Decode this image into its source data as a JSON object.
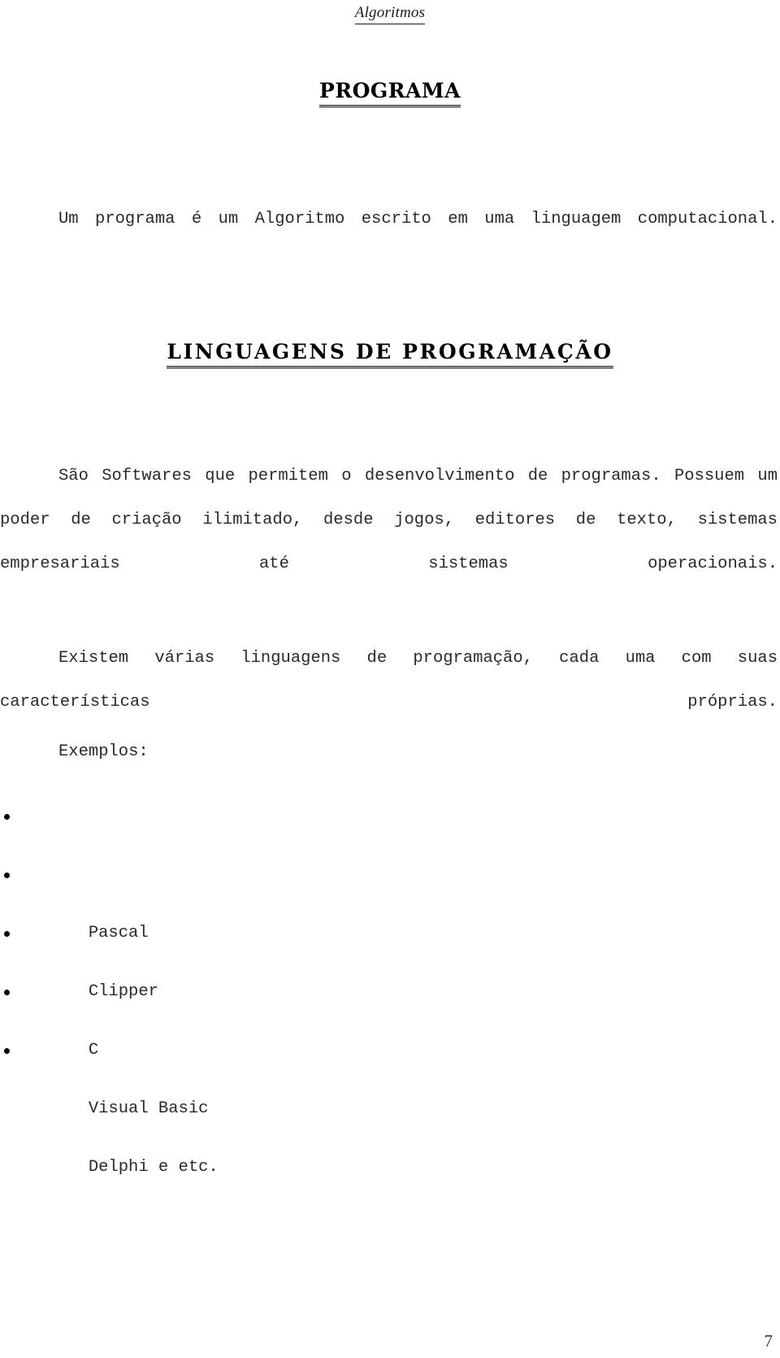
{
  "document": {
    "running_header": "Algoritmos",
    "page_number": "7",
    "text_color": "#2a2a2a",
    "heading_color": "#000000",
    "background": "#ffffff"
  },
  "sections": {
    "programa": {
      "heading": "PROGRAMA",
      "paragraph": "Um programa é um Algoritmo escrito em uma linguagem computacional."
    },
    "linguagens": {
      "heading": "LINGUAGENS DE PROGRAMAÇÃO",
      "paragraph_1": "São Softwares que permitem o desenvolvimento de programas. Possuem um poder de criação ilimitado, desde jogos, editores de texto, sistemas empresariais até sistemas operacionais.",
      "paragraph_2": "Existem várias linguagens de programação, cada uma com suas características próprias.",
      "examples_label": "Exemplos:",
      "examples": [
        {
          "label": "Pascal"
        },
        {
          "label": "Clipper"
        },
        {
          "label": "C"
        },
        {
          "label": "Visual Basic"
        },
        {
          "label": "Delphi e etc."
        }
      ]
    }
  }
}
